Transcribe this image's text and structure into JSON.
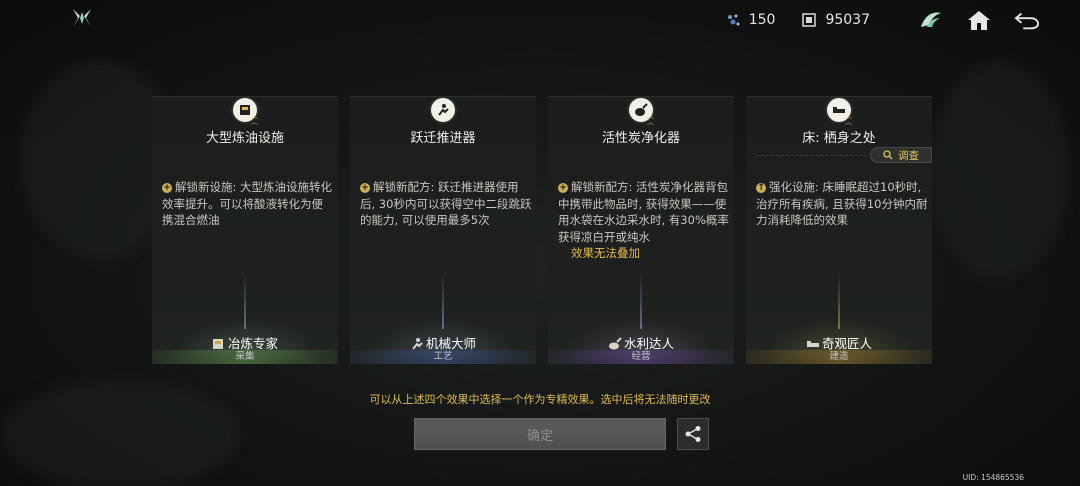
{
  "header": {
    "currencies": [
      {
        "icon": "crystal-currency-icon",
        "value": "150"
      },
      {
        "icon": "chip-currency-icon",
        "value": "95037"
      }
    ],
    "icons": [
      "wing-emblem-icon",
      "home-icon",
      "back-arrow-icon"
    ]
  },
  "cards": [
    {
      "title": "大型炼油设施",
      "icon": "oil-facility-icon",
      "description": "解锁新设施: 大型炼油设施转化效率提升。可以将酸液转化为便携混合燃油",
      "warning": "",
      "profession": "冶炼专家",
      "category": "采集",
      "category_color": "#4a6e3e"
    },
    {
      "title": "跃迁推进器",
      "icon": "thruster-icon",
      "description": "解锁新配方: 跃迁推进器使用后, 30秒内可以获得空中二段跳跃的能力, 可以使用最多5次",
      "warning": "",
      "profession": "机械大师",
      "category": "工艺",
      "category_color": "#344468"
    },
    {
      "title": "活性炭净化器",
      "icon": "purifier-icon",
      "description": "解锁新配方: 活性炭净化器背包中携带此物品时, 获得效果——使用水袋在水边采水时, 有30%概率获得凉白开或纯水",
      "warning": "效果无法叠加",
      "profession": "水利达人",
      "category": "经营",
      "category_color": "#4e3a6c"
    },
    {
      "title": "床: 栖身之处",
      "icon": "bed-icon",
      "description": "强化设施: 床睡眠超过10秒时, 治疗所有疾病, 且获得10分钟内耐力消耗降低的效果",
      "warning": "",
      "profession": "奇观匠人",
      "category": "建造",
      "category_color": "#6e5a28",
      "inspect_label": "调查"
    }
  ],
  "hint": "可以从上述四个效果中选择一个作为专精效果。选中后将无法随时更改",
  "confirm_label": "确定",
  "uid": "UID: 154865536",
  "colors": {
    "accent": "#e0b94c",
    "background": "#141716"
  }
}
